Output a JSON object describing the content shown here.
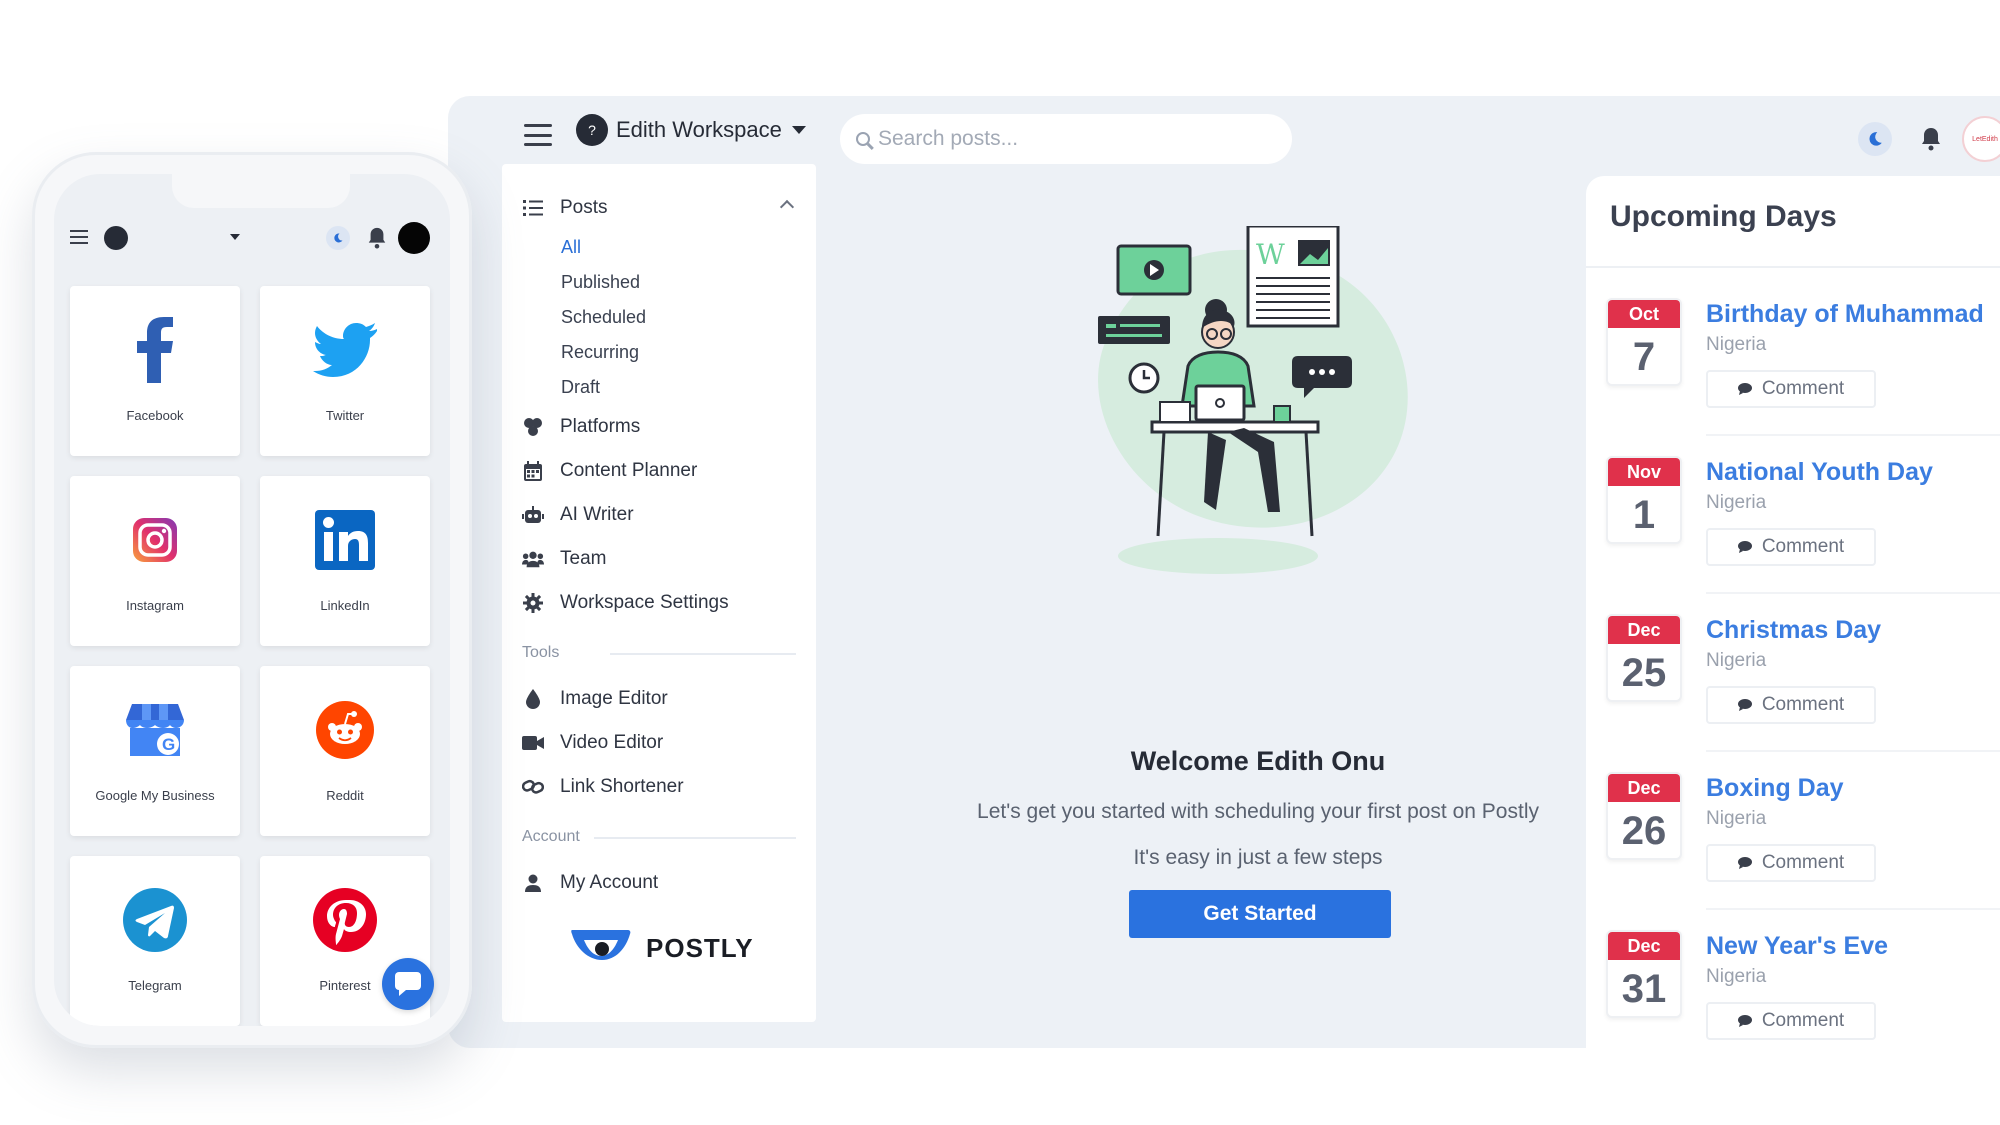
{
  "header": {
    "workspace_name": "Edith Workspace",
    "search_placeholder": "Search posts...",
    "avatar_text": "LetEdith"
  },
  "sidebar": {
    "posts_label": "Posts",
    "posts_sub": [
      "All",
      "Published",
      "Scheduled",
      "Recurring",
      "Draft"
    ],
    "items": [
      {
        "label": "Platforms",
        "icon": "platforms-icon"
      },
      {
        "label": "Content Planner",
        "icon": "calendar-icon"
      },
      {
        "label": "AI Writer",
        "icon": "robot-icon"
      },
      {
        "label": "Team",
        "icon": "team-icon"
      },
      {
        "label": "Workspace Settings",
        "icon": "gear-icon"
      }
    ],
    "tools_heading": "Tools",
    "tools": [
      {
        "label": "Image Editor",
        "icon": "droplet-icon"
      },
      {
        "label": "Video Editor",
        "icon": "video-icon"
      },
      {
        "label": "Link Shortener",
        "icon": "link-icon"
      }
    ],
    "account_heading": "Account",
    "account_item": "My Account",
    "brand": "POSTLY"
  },
  "welcome": {
    "title": "Welcome Edith Onu",
    "subtitle": "Let's get you started with scheduling your first post on Postly",
    "subtitle2": "It's easy in just a few steps",
    "cta": "Get Started"
  },
  "upcoming": {
    "title": "Upcoming Days",
    "comment_label": "Comment",
    "events": [
      {
        "month": "Oct",
        "day": "7",
        "name": "Birthday of Muhammad",
        "country": "Nigeria"
      },
      {
        "month": "Nov",
        "day": "1",
        "name": "National Youth Day",
        "country": "Nigeria"
      },
      {
        "month": "Dec",
        "day": "25",
        "name": "Christmas Day",
        "country": "Nigeria"
      },
      {
        "month": "Dec",
        "day": "26",
        "name": "Boxing Day",
        "country": "Nigeria"
      },
      {
        "month": "Dec",
        "day": "31",
        "name": "New Year's Eve",
        "country": "Nigeria"
      }
    ]
  },
  "phone": {
    "tiles": [
      {
        "label": "Facebook",
        "icon": "facebook-icon"
      },
      {
        "label": "Twitter",
        "icon": "twitter-icon"
      },
      {
        "label": "Instagram",
        "icon": "instagram-icon"
      },
      {
        "label": "LinkedIn",
        "icon": "linkedin-icon"
      },
      {
        "label": "Google My Business",
        "icon": "google-my-business-icon"
      },
      {
        "label": "Reddit",
        "icon": "reddit-icon"
      },
      {
        "label": "Telegram",
        "icon": "telegram-icon"
      },
      {
        "label": "Pinterest",
        "icon": "pinterest-icon"
      }
    ]
  },
  "colors": {
    "accent": "#2a72df",
    "calendar_red": "#e0314b",
    "link_blue": "#3b7de0",
    "background": "#edf1f6"
  }
}
